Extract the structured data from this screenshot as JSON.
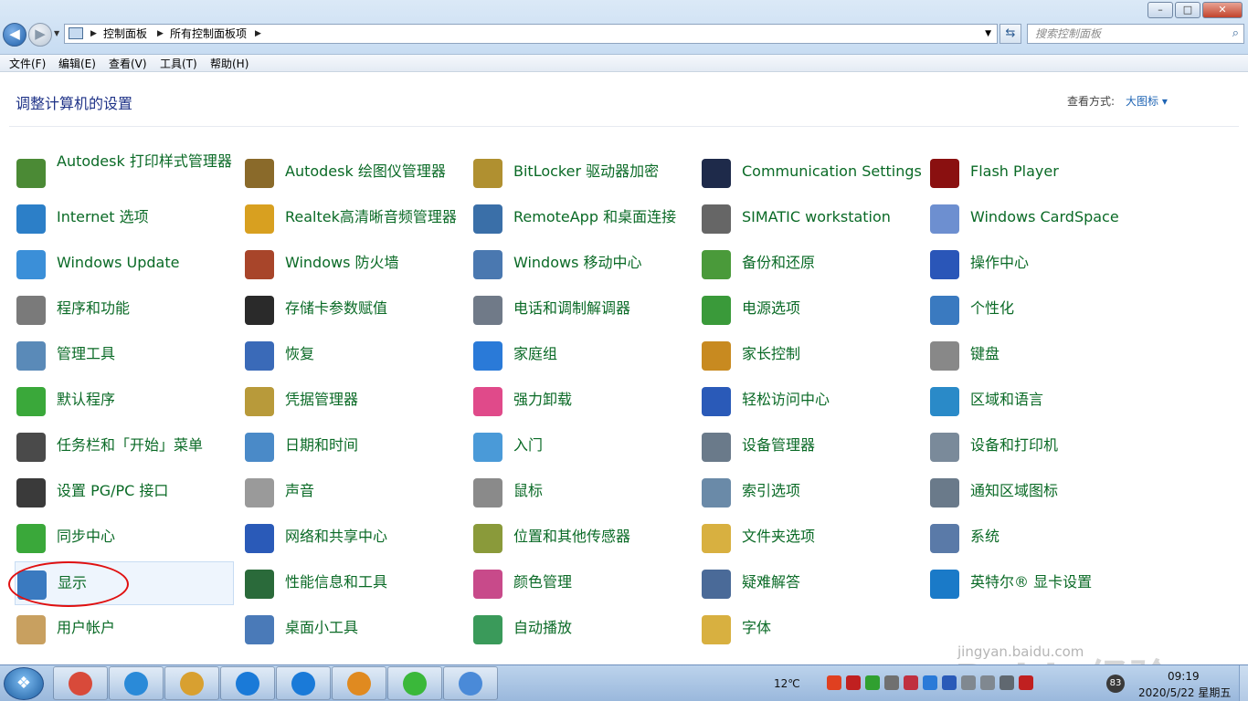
{
  "window": {
    "breadcrumb": [
      "控制面板",
      "所有控制面板项"
    ],
    "search_placeholder": "搜索控制面板"
  },
  "menu": [
    "文件(F)",
    "编辑(E)",
    "查看(V)",
    "工具(T)",
    "帮助(H)"
  ],
  "content": {
    "heading": "调整计算机的设置",
    "view_by_label": "查看方式:",
    "view_by_value": "大图标 ▾"
  },
  "items": [
    {
      "label": "Autodesk 打印样式管理器",
      "icon": "autodesk-print-style-icon",
      "color": "#4b8a35"
    },
    {
      "label": "Autodesk 绘图仪管理器",
      "icon": "autodesk-plotter-icon",
      "color": "#8a6a2a"
    },
    {
      "label": "BitLocker 驱动器加密",
      "icon": "bitlocker-key-icon",
      "color": "#b09030"
    },
    {
      "label": "Communication Settings",
      "icon": "com-set-icon",
      "color": "#1e2a4a"
    },
    {
      "label": "Flash Player",
      "icon": "flash-player-icon",
      "color": "#8a1010"
    },
    {
      "label": "Internet 选项",
      "icon": "internet-options-icon",
      "color": "#2c7fc8"
    },
    {
      "label": "Realtek高清晰音频管理器",
      "icon": "realtek-audio-icon",
      "color": "#d8a020"
    },
    {
      "label": "RemoteApp 和桌面连接",
      "icon": "remoteapp-icon",
      "color": "#3a6fa8"
    },
    {
      "label": "SIMATIC workstation",
      "icon": "simatic-icon",
      "color": "#666666"
    },
    {
      "label": "Windows CardSpace",
      "icon": "cardspace-icon",
      "color": "#6d8fd0"
    },
    {
      "label": "Windows Update",
      "icon": "windows-update-icon",
      "color": "#3b8fd8"
    },
    {
      "label": "Windows 防火墙",
      "icon": "firewall-icon",
      "color": "#a8452a"
    },
    {
      "label": "Windows 移动中心",
      "icon": "mobility-center-icon",
      "color": "#4a78b0"
    },
    {
      "label": "备份和还原",
      "icon": "backup-restore-icon",
      "color": "#4a9a3a"
    },
    {
      "label": "操作中心",
      "icon": "action-center-flag-icon",
      "color": "#2a56b8"
    },
    {
      "label": "程序和功能",
      "icon": "programs-features-icon",
      "color": "#7a7a7a"
    },
    {
      "label": "存储卡参数赋值",
      "icon": "memory-card-icon",
      "color": "#2a2a2a"
    },
    {
      "label": "电话和调制解调器",
      "icon": "phone-modem-icon",
      "color": "#707a88"
    },
    {
      "label": "电源选项",
      "icon": "power-options-icon",
      "color": "#3a9a3a"
    },
    {
      "label": "个性化",
      "icon": "personalization-icon",
      "color": "#3a7ac0"
    },
    {
      "label": "管理工具",
      "icon": "admin-tools-icon",
      "color": "#5a8ab8"
    },
    {
      "label": "恢复",
      "icon": "recovery-icon",
      "color": "#3a6ab8"
    },
    {
      "label": "家庭组",
      "icon": "homegroup-icon",
      "color": "#2a7ad8"
    },
    {
      "label": "家长控制",
      "icon": "parental-controls-icon",
      "color": "#c88a20"
    },
    {
      "label": "键盘",
      "icon": "keyboard-icon",
      "color": "#888888"
    },
    {
      "label": "默认程序",
      "icon": "default-programs-icon",
      "color": "#3aa83a"
    },
    {
      "label": "凭据管理器",
      "icon": "credential-manager-icon",
      "color": "#b89a3a"
    },
    {
      "label": "强力卸载",
      "icon": "uninstall-clover-icon",
      "color": "#e04a8a"
    },
    {
      "label": "轻松访问中心",
      "icon": "ease-of-access-icon",
      "color": "#2a5ab8"
    },
    {
      "label": "区域和语言",
      "icon": "region-language-icon",
      "color": "#2a8ac8"
    },
    {
      "label": "任务栏和「开始」菜单",
      "icon": "taskbar-start-menu-icon",
      "color": "#4a4a4a"
    },
    {
      "label": "日期和时间",
      "icon": "date-time-icon",
      "color": "#4a8ac8"
    },
    {
      "label": "入门",
      "icon": "getting-started-icon",
      "color": "#4a9ad8"
    },
    {
      "label": "设备管理器",
      "icon": "device-manager-icon",
      "color": "#6a7a8a"
    },
    {
      "label": "设备和打印机",
      "icon": "devices-printers-icon",
      "color": "#7a8a9a"
    },
    {
      "label": "设置 PG/PC 接口",
      "icon": "pg-pc-interface-icon",
      "color": "#3a3a3a"
    },
    {
      "label": "声音",
      "icon": "sound-speaker-icon",
      "color": "#9a9a9a"
    },
    {
      "label": "鼠标",
      "icon": "mouse-icon",
      "color": "#8a8a8a"
    },
    {
      "label": "索引选项",
      "icon": "indexing-options-icon",
      "color": "#6a8aa8"
    },
    {
      "label": "通知区域图标",
      "icon": "notification-area-icon",
      "color": "#6a7a8a"
    },
    {
      "label": "同步中心",
      "icon": "sync-center-icon",
      "color": "#3aa83a"
    },
    {
      "label": "网络和共享中心",
      "icon": "network-sharing-icon",
      "color": "#2a5ab8"
    },
    {
      "label": "位置和其他传感器",
      "icon": "location-sensors-icon",
      "color": "#8a9a3a"
    },
    {
      "label": "文件夹选项",
      "icon": "folder-options-icon",
      "color": "#d8b040"
    },
    {
      "label": "系统",
      "icon": "system-icon",
      "color": "#5a7aa8"
    },
    {
      "label": "显示",
      "icon": "display-monitor-icon",
      "color": "#3a7ac0"
    },
    {
      "label": "性能信息和工具",
      "icon": "performance-icon",
      "color": "#2a6a3a"
    },
    {
      "label": "颜色管理",
      "icon": "color-management-icon",
      "color": "#c84a8a"
    },
    {
      "label": "疑难解答",
      "icon": "troubleshooting-icon",
      "color": "#4a6a98"
    },
    {
      "label": "英特尔® 显卡设置",
      "icon": "intel-graphics-icon",
      "color": "#1a7ac8"
    },
    {
      "label": "用户帐户",
      "icon": "user-accounts-icon",
      "color": "#c8a060"
    },
    {
      "label": "桌面小工具",
      "icon": "desktop-gadgets-icon",
      "color": "#4a7ab8"
    },
    {
      "label": "自动播放",
      "icon": "autoplay-icon",
      "color": "#3a9a5a"
    },
    {
      "label": "字体",
      "icon": "fonts-icon",
      "color": "#d8b040"
    }
  ],
  "watermark": {
    "text": "Baidu经验",
    "url": "jingyan.baidu.com"
  },
  "taskbar": {
    "buttons": [
      {
        "name": "chrome",
        "color": "#d84a3a"
      },
      {
        "name": "internet-explorer",
        "color": "#2a8ad8"
      },
      {
        "name": "explorer",
        "color": "#d8a030"
      },
      {
        "name": "tencent-guard-1",
        "color": "#1a7ad8"
      },
      {
        "name": "tencent-guard-2",
        "color": "#1a7ad8"
      },
      {
        "name": "pdf-reader",
        "color": "#e08a20"
      },
      {
        "name": "wechat",
        "color": "#3ab83a"
      },
      {
        "name": "control-panel",
        "color": "#4a8ad8"
      }
    ],
    "weather": "12℃",
    "time": "09:19",
    "date": "2020/5/22 星期五",
    "badge": "83"
  }
}
